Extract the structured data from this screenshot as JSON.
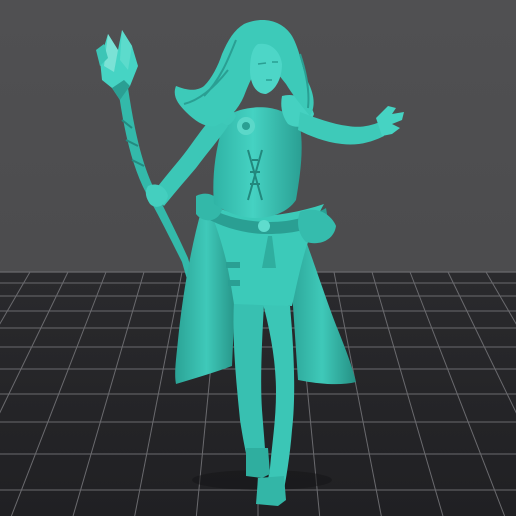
{
  "scene": {
    "model_color": "#40cdbd",
    "model_shadow_color": "#2a9b8f",
    "model_highlight_color": "#79e3d6",
    "background_color": "#4d4d4f",
    "floor_color": "#262629",
    "grid_color": "#6a6a6e",
    "grid_major_color": "#8a8a8e"
  }
}
